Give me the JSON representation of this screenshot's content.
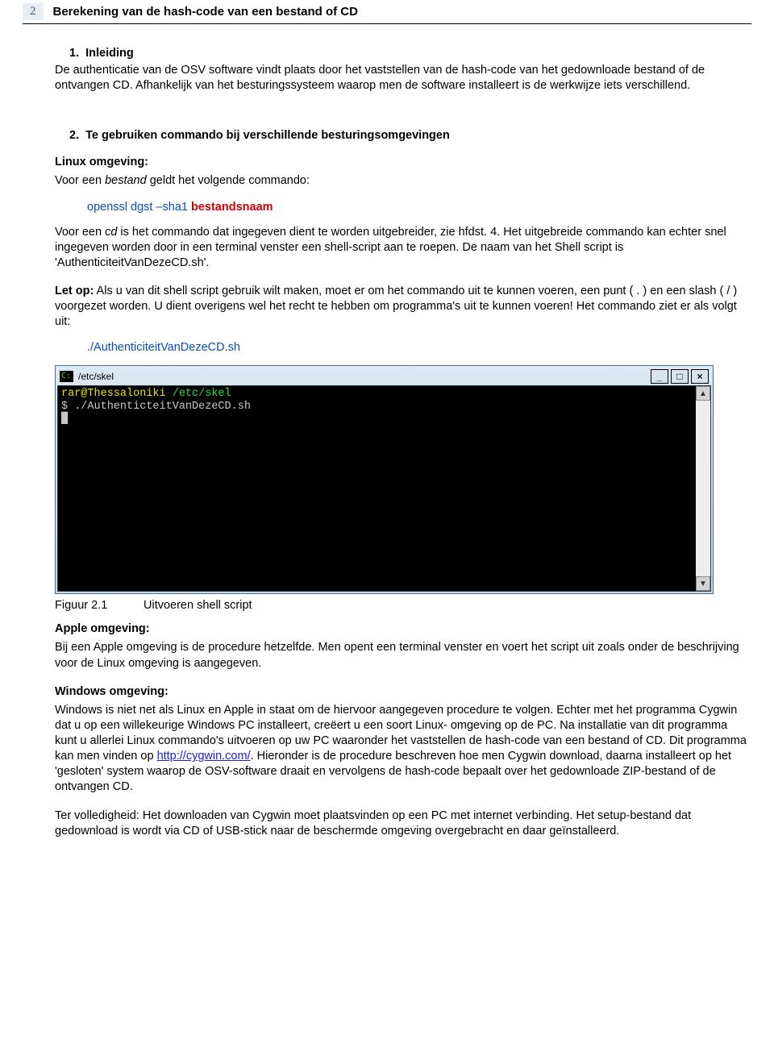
{
  "page_number": "2",
  "header_title": "Berekening van de hash-code van een bestand of CD",
  "s1": {
    "num": "1.",
    "title": "Inleiding",
    "para": "De authenticatie van de OSV software vindt plaats door het vaststellen van de hash-code van het gedownloade bestand of de ontvangen CD. Afhankelijk van het besturingssysteem waarop men de software installeert is de werkwijze iets verschillend."
  },
  "s2": {
    "num": "2.",
    "title": "Te gebruiken commando bij verschillende besturingsomgevingen",
    "linux_hdr": "Linux omgeving:",
    "linux_p1a": "Voor een ",
    "linux_p1_em": "bestand",
    "linux_p1b": " geldt het volgende commando:",
    "cmd1_blue": "openssl dgst –sha1 ",
    "cmd1_red": "bestandsnaam",
    "linux_p2a": "Voor een ",
    "linux_p2_em": "cd",
    "linux_p2b": " is het commando dat ingegeven dient te worden uitgebreider, zie hfdst. 4. Het uitgebreide commando kan echter snel ingegeven worden door in een terminal venster een shell-script aan te roepen. De naam van het Shell script is 'AuthenticiteitVanDezeCD.sh'.",
    "letop_label": "Let op:",
    "letop_rest": " Als u van dit shell script gebruik wilt maken, moet er om het commando uit te kunnen voeren, een punt ( . ) en een slash ( / ) voorgezet worden. U dient overigens wel het recht te hebben om programma's uit te kunnen voeren! Het commando ziet er als volgt uit:",
    "cmd2": "./AuthenticiteitVanDezeCD.sh"
  },
  "terminal": {
    "path": "/etc/skel",
    "line1_yellow": "rar@Thessaloniki ",
    "line1_green": "/etc/skel",
    "line2": "$ ./AuthenticteitVanDezeCD.sh"
  },
  "fig": {
    "label": "Figuur 2.1",
    "caption": "Uitvoeren shell script"
  },
  "apple": {
    "hdr": "Apple omgeving:",
    "para": "Bij een Apple omgeving is de procedure hetzelfde. Men opent een terminal venster en voert het script uit zoals onder de beschrijving voor de Linux omgeving is aangegeven."
  },
  "windows": {
    "hdr": "Windows omgeving:",
    "p1a": "Windows is niet net als Linux en Apple in staat om de hiervoor aangegeven procedure te volgen. Echter met het programma Cygwin dat u op een willekeurige Windows PC installeert, creëert u een soort Linux- omgeving op de PC. Na installatie van dit programma kunt u allerlei Linux commando's uitvoeren op uw PC waaronder het vaststellen de hash-code van een bestand of CD. Dit programma kan men vinden op ",
    "link": "http://cygwin.com/",
    "p1b": ". Hieronder is de procedure beschreven hoe men Cygwin download, daarna installeert op het 'gesloten' system waarop de OSV-software draait en vervolgens de hash-code bepaalt over het gedownloade ZIP-bestand of de ontvangen CD.",
    "p2": "Ter volledigheid: Het downloaden van Cygwin moet plaatsvinden op een PC met internet verbinding. Het setup-bestand dat gedownload is wordt via CD of USB-stick naar de beschermde omgeving overgebracht en daar geïnstalleerd."
  }
}
